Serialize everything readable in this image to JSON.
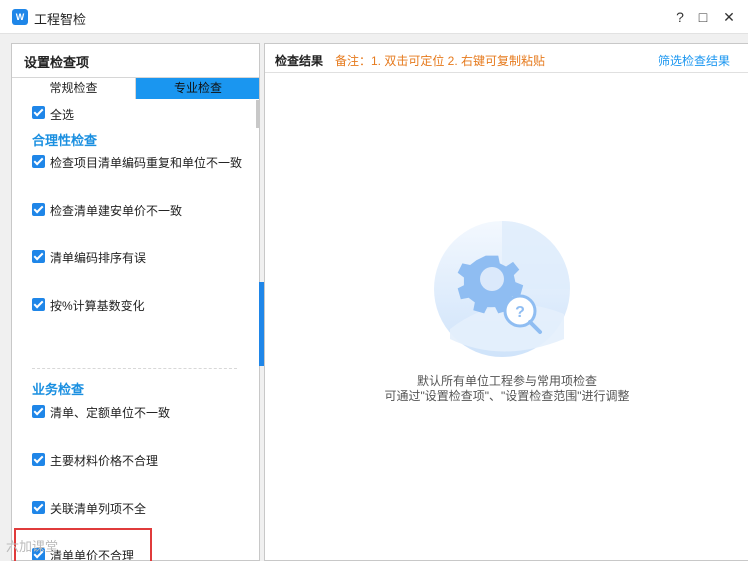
{
  "window": {
    "icon_text": "W",
    "title": "工程智检",
    "help_icon": "?",
    "maximize_icon": "□",
    "close_icon": "✕"
  },
  "left_panel": {
    "title": "设置检查项",
    "tabs": [
      {
        "label": "常规检查",
        "active": false
      },
      {
        "label": "专业检查",
        "active": true
      }
    ],
    "select_all": "全选",
    "sections": [
      {
        "title": "合理性检查",
        "items": [
          "检查项目清单编码重复和单位不一致",
          "检查清单建安单价不一致",
          "清单编码排序有误",
          "按%计算基数变化"
        ]
      },
      {
        "title": "业务检查",
        "items": [
          "清单、定额单位不一致",
          "主要材料价格不合理",
          "关联清单列项不全",
          "清单单价不合理"
        ]
      }
    ],
    "watermark": "六加课堂"
  },
  "right_panel": {
    "title": "检查结果",
    "note": "备注：1. 双击可定位 2. 右键可复制粘贴",
    "filter_link": "筛选检查结果",
    "empty_line1": "默认所有单位工程参与常用项检查",
    "empty_line2": "可通过\"设置检查项\"、\"设置检查范围\"进行调整"
  },
  "colors": {
    "accent": "#1a96f0",
    "checkbox": "#1f86e8",
    "note": "#e67a1d",
    "highlight_box": "#e03b3b"
  }
}
